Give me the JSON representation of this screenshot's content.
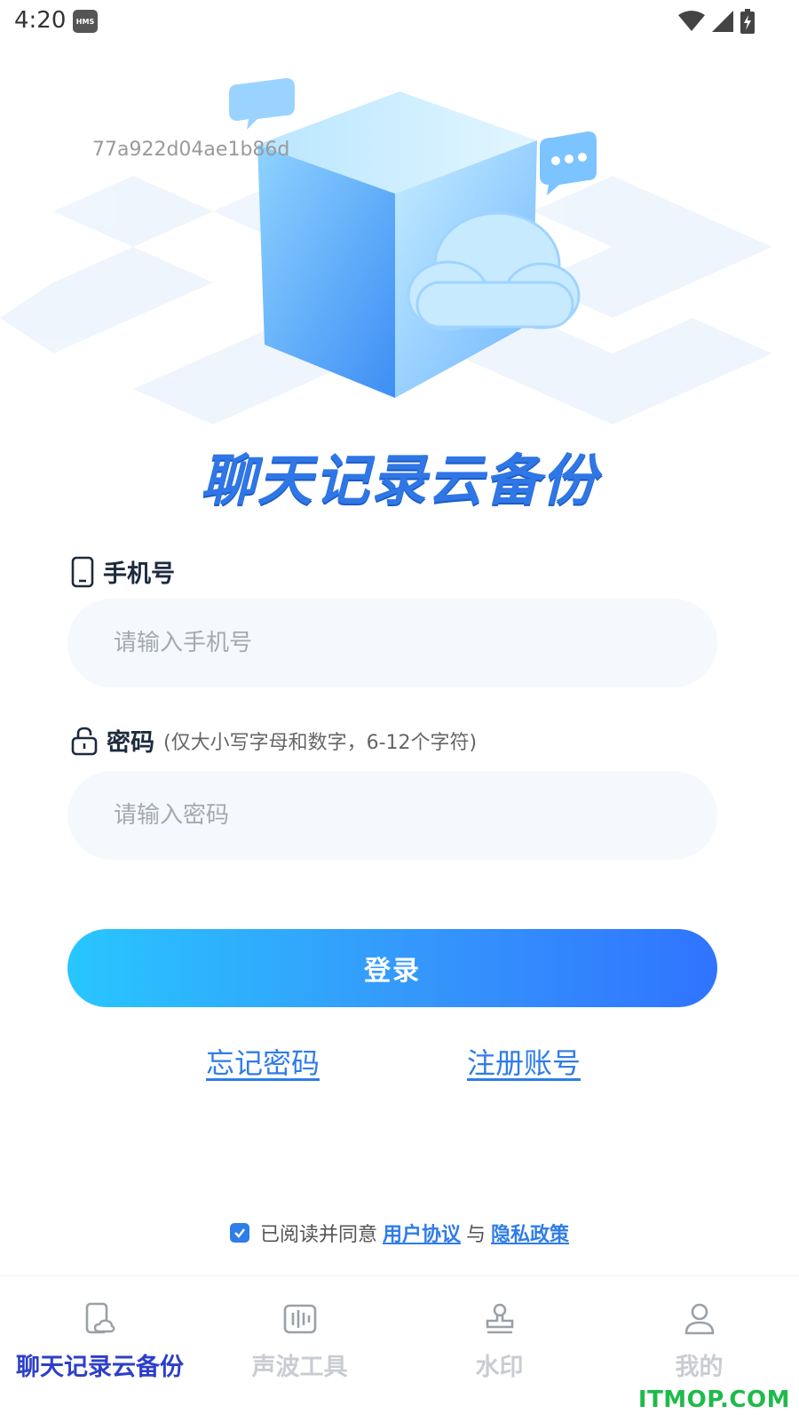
{
  "status_bar": {
    "time": "4:20",
    "hms_badge": "HMS"
  },
  "hero": {
    "device_id": "77a922d04ae1b86d",
    "app_title": "聊天记录云备份"
  },
  "phone": {
    "label": "手机号",
    "placeholder": "请输入手机号"
  },
  "password": {
    "label": "密码",
    "hint": "(仅大小写字母和数字，6-12个字符)",
    "placeholder": "请输入密码"
  },
  "actions": {
    "login": "登录",
    "forgot": "忘记密码",
    "register": "注册账号"
  },
  "agreement": {
    "text": "已阅读并同意",
    "user_agreement": "用户协议",
    "and": "与",
    "privacy_policy": "隐私政策",
    "checked": true
  },
  "tabs": [
    {
      "label": "聊天记录云备份",
      "icon": "phone-cloud-icon",
      "active": true
    },
    {
      "label": "声波工具",
      "icon": "soundwave-icon",
      "active": false
    },
    {
      "label": "水印",
      "icon": "stamp-icon",
      "active": false
    },
    {
      "label": "我的",
      "icon": "person-icon",
      "active": false
    }
  ],
  "colors": {
    "accent": "#2f7de8",
    "title_blue": "#2f76e6",
    "active_tab": "#2d3fc9",
    "inactive_tab": "#c9ccd2",
    "watermark": "#1fba4a"
  },
  "watermark": "ITMOP.COM"
}
